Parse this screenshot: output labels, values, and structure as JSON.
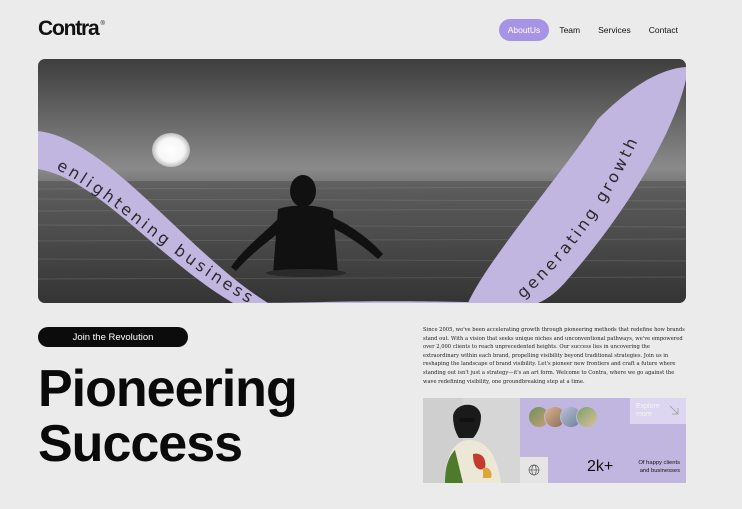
{
  "brand": {
    "logo": "Contra",
    "mark": "®"
  },
  "nav": {
    "items": [
      "AboutUs",
      "Team",
      "Services",
      "Contact"
    ],
    "active": "AboutUs"
  },
  "hero": {
    "ribbon_left": "enlightening business",
    "ribbon_right": "generating growth"
  },
  "cta": {
    "label": "Join the Revolution"
  },
  "headline": {
    "line1": "Pioneering",
    "line2": "Success"
  },
  "about": {
    "text": "Since 2005, we've been accelerating growth through pioneering methods that redefine how brands stand out. With a vision that seeks unique niches and unconventional pathways, we've empowered over 2,000 clients to reach unprecedented heights. Our success lies in uncovering the extraordinary within each brand, propelling visibility beyond traditional strategies. Join us in reshaping the landscape of brand visibility. Let's pioneer new frontiers and craft a future where standing out isn't just a strategy—it's an art form. Welcome to Contra, where we go against the wave redefining visibility, one groundbreaking step at a time."
  },
  "stats": {
    "explore": "Explore more",
    "count": "2k+",
    "count_label_1": "Of happy clients",
    "count_label_2": "and businesses"
  },
  "colors": {
    "accent": "#a794e6",
    "ribbon": "#c1b6e0",
    "background": "#ebebeb"
  },
  "icons": [
    "arrow-down-right-icon",
    "globe-icon"
  ]
}
